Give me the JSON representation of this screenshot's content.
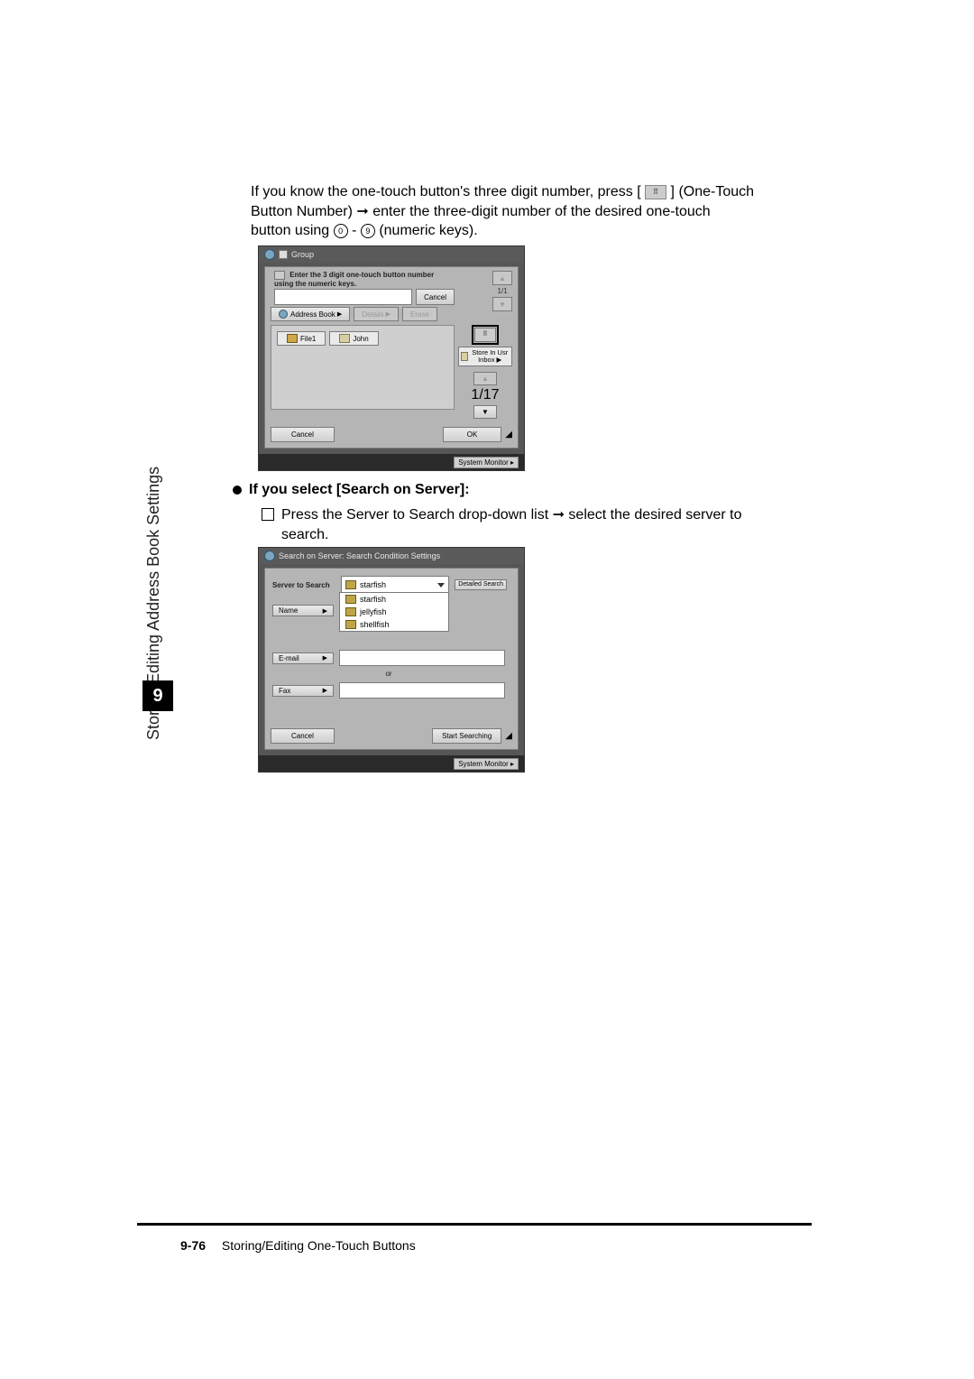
{
  "side": {
    "label": "Storing/Editing Address Book Settings",
    "chapter": "9"
  },
  "intro": {
    "line1_a": "If you know the one-touch button's three digit number, press [",
    "line1_b": "] (One-Touch",
    "line2": "Button Number) ➞ enter the three-digit number of the desired one-touch",
    "line3_a": "button using ",
    "line3_b": " - ",
    "line3_c": " (numeric keys).",
    "key0": "0",
    "key9": "9",
    "iconAbbr": "⠿"
  },
  "sc1": {
    "title": "Group",
    "note": "Enter the 3 digit one-touch button number using the numeric keys.",
    "cancel": "Cancel",
    "addressBook": "Address Book",
    "details": "Details",
    "erase": "Erase",
    "file1": "File1",
    "john": "John",
    "storeInInbox": "Store In Usr Inbox ▶",
    "topPager": {
      "count": "1/1"
    },
    "midPager": {
      "count": "1/17"
    },
    "ok": "OK",
    "corner": "◢",
    "sysMonitor": "System Monitor ▸",
    "oneTouchAbbr": "⠿"
  },
  "bullet": {
    "heading": "If you select [Search on Server]:",
    "sub": "Press the Server to Search drop-down list ➞ select the desired server to search."
  },
  "sc2": {
    "title": "Search on Server: Search Condition Settings",
    "serverToSearch": "Server to Search",
    "selected": "starfish",
    "options": [
      "starfish",
      "jellyfish",
      "shellfish"
    ],
    "detailedSearch": "Detailed Search",
    "name": "Name",
    "email": "E-mail",
    "or": "or",
    "fax": "Fax",
    "cancel": "Cancel",
    "start": "Start Searching",
    "corner": "◢",
    "sysMonitor": "System Monitor ▸"
  },
  "footer": {
    "page": "9-76",
    "title": "Storing/Editing One-Touch Buttons"
  }
}
